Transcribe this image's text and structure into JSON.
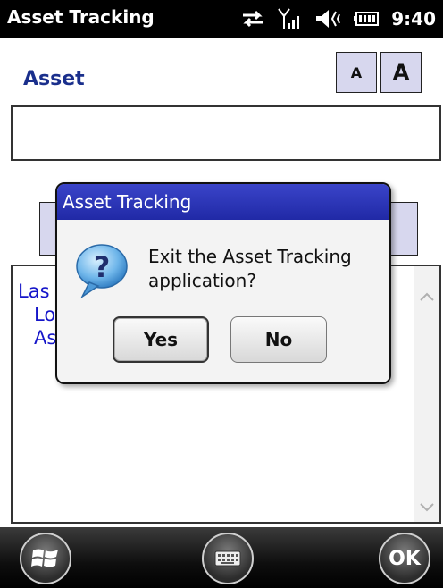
{
  "statusbar": {
    "title": "Asset Tracking",
    "time": "9:40",
    "icons": [
      "sync-arrows-icon",
      "signal-strength-icon",
      "volume-icon",
      "battery-icon"
    ]
  },
  "header": {
    "title": "Asset",
    "font_small_label": "A",
    "font_large_label": "A"
  },
  "search": {
    "value": ""
  },
  "list": {
    "lines": [
      "Las",
      "Lo",
      "As"
    ]
  },
  "dialog": {
    "title": "Asset Tracking",
    "message": "Exit the Asset Tracking application?",
    "yes_label": "Yes",
    "no_label": "No",
    "icon": "question-icon"
  },
  "bottombar": {
    "ok_label": "OK",
    "start_icon": "windows-start-icon",
    "keyboard_icon": "keyboard-icon"
  },
  "colors": {
    "accent_title": "#1a2f8c",
    "list_text": "#1515c9",
    "dialog_title_bar": "#2b35b8",
    "button_face": "#d7d7ee"
  }
}
